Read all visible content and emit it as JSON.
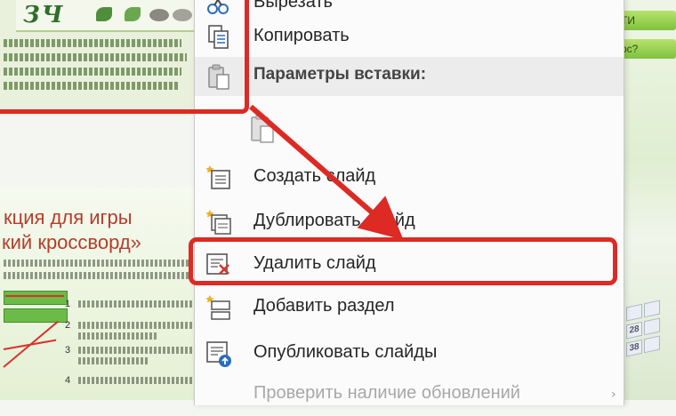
{
  "background": {
    "logo_text": "ЗЧ",
    "slide_title_1": "кция для игры",
    "slide_title_2": "кий кроссворд»",
    "steps": [
      "1",
      "2",
      "3",
      "4"
    ],
    "right_buttons": [
      "ТИ",
      "рс?"
    ],
    "calendar": [
      "",
      "",
      "28",
      "",
      "38",
      ""
    ]
  },
  "context_menu": {
    "items": [
      {
        "id": "cut",
        "label": "Вырезать",
        "icon": "scissors-icon",
        "disabled": false
      },
      {
        "id": "copy",
        "label": "Копировать",
        "icon": "copy-icon",
        "disabled": false
      },
      {
        "id": "paste_options",
        "label": "Параметры вставки:",
        "icon": "paste-icon",
        "is_header": true
      },
      {
        "id": "paste_keep",
        "label": "",
        "icon": "paste-icon",
        "disabled": false
      },
      {
        "id": "new_slide",
        "label": "Создать слайд",
        "icon": "new-slide-icon",
        "disabled": false
      },
      {
        "id": "duplicate",
        "label": "Дублировать слайд",
        "icon": "duplicate-slide-icon",
        "disabled": false
      },
      {
        "id": "delete",
        "label": "Удалить слайд",
        "icon": "delete-slide-icon",
        "disabled": false
      },
      {
        "id": "add_section",
        "label": "Добавить раздел",
        "icon": "add-section-icon",
        "disabled": false
      },
      {
        "id": "publish",
        "label": "Опубликовать слайды",
        "icon": "publish-slides-icon",
        "disabled": false
      },
      {
        "id": "check_updates",
        "label": "Проверить наличие обновлений",
        "icon": "chevron-right-icon",
        "disabled": true
      }
    ]
  },
  "colors": {
    "annotation_red": "#dd2a24",
    "menu_bg": "#fbfbfb",
    "header_bg": "#ececec"
  }
}
